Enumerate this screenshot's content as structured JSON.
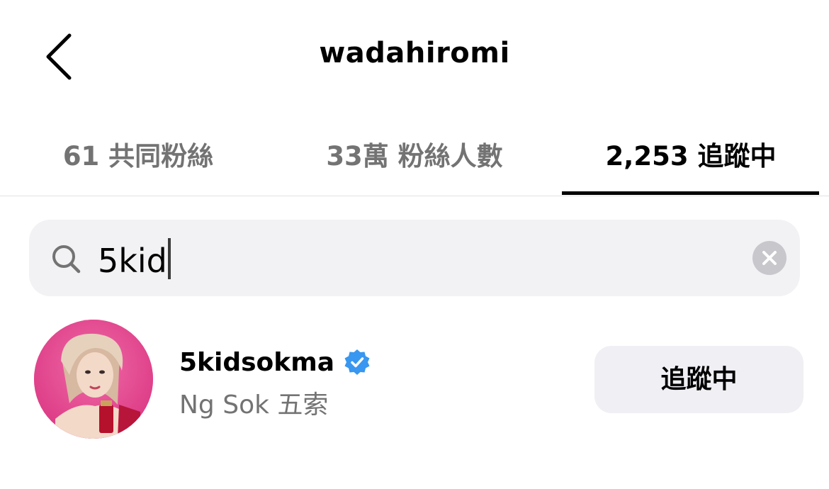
{
  "header": {
    "title": "wadahiromi"
  },
  "tabs": [
    {
      "label": "61 共同粉絲",
      "active": false
    },
    {
      "label": "33萬 粉絲人數",
      "active": false
    },
    {
      "label": "2,253 追蹤中",
      "active": true
    }
  ],
  "search": {
    "value": "5kid",
    "icon": "search-icon",
    "clear_icon": "clear-icon"
  },
  "results": [
    {
      "username": "5kidsokma",
      "verified": true,
      "full_name": "Ng Sok 五索",
      "button_label": "追蹤中"
    }
  ],
  "colors": {
    "verified": "#3897f0",
    "muted_text": "#737373",
    "search_bg": "#f2f2f4",
    "button_bg": "#efeff4",
    "avatar_bg": "#e2468d"
  }
}
